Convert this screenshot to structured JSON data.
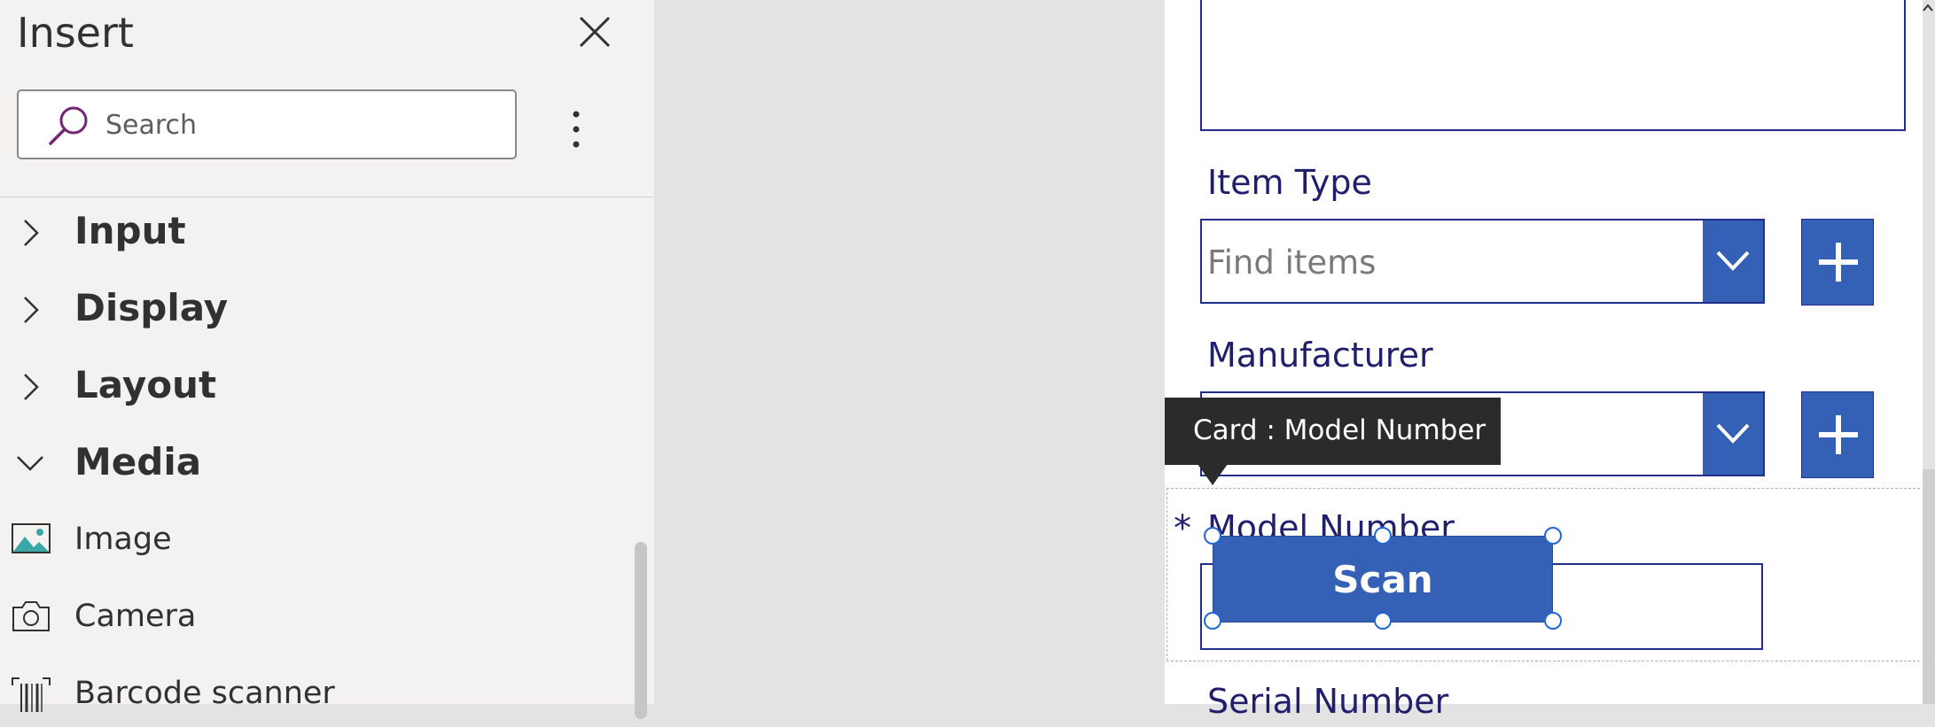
{
  "insert_pane": {
    "title": "Insert",
    "search": {
      "placeholder": "Search",
      "value": ""
    },
    "categories": [
      {
        "label": "Input",
        "expanded": false
      },
      {
        "label": "Display",
        "expanded": false
      },
      {
        "label": "Layout",
        "expanded": false
      },
      {
        "label": "Media",
        "expanded": true
      }
    ],
    "media_items": [
      {
        "label": "Image",
        "icon": "image-icon"
      },
      {
        "label": "Camera",
        "icon": "camera-icon"
      },
      {
        "label": "Barcode scanner",
        "icon": "barcode-icon"
      }
    ]
  },
  "screen": {
    "item_type": {
      "label": "Item Type",
      "placeholder": "Find items"
    },
    "manufacturer": {
      "label": "Manufacturer",
      "placeholder": ""
    },
    "model_number": {
      "required_marker": "*",
      "label": "Model Number"
    },
    "serial_number": {
      "label": "Serial Number"
    },
    "scan_button": {
      "label": "Scan"
    },
    "tooltip": "Card : Model Number"
  },
  "colors": {
    "accent": "#3460b6",
    "label": "#201f6e",
    "border": "#1f2f8a",
    "pane_bg": "#f3f2f1",
    "search_icon": "#742774"
  }
}
